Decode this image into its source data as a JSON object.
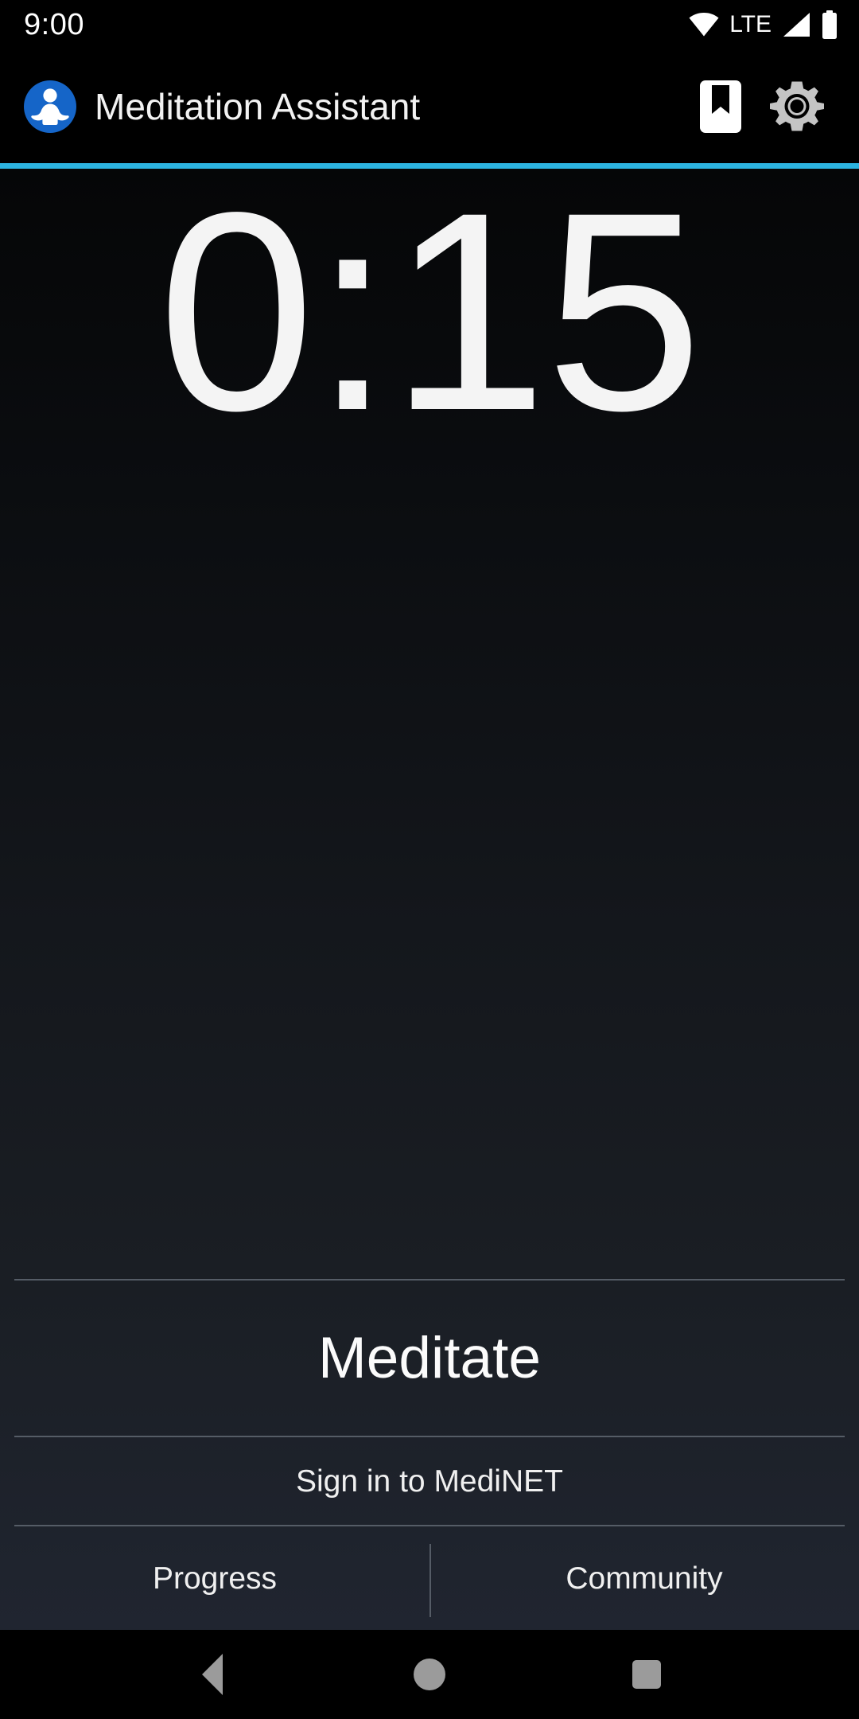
{
  "status_bar": {
    "clock": "9:00",
    "network_label": "LTE",
    "icons": [
      "wifi-icon",
      "cellular-signal-icon",
      "battery-icon"
    ]
  },
  "app_bar": {
    "logo_icon": "meditation-lotus-icon",
    "title": "Meditation Assistant",
    "actions": [
      {
        "icon": "bookmark-icon",
        "name": "bookmark-button"
      },
      {
        "icon": "gear-icon",
        "name": "settings-button"
      }
    ],
    "accent_color": "#2cb3e0"
  },
  "timer": {
    "value": "0:15"
  },
  "actions": {
    "meditate_label": "Meditate",
    "signin_label": "Sign in to MediNET",
    "tabs": [
      {
        "label": "Progress"
      },
      {
        "label": "Community"
      }
    ]
  },
  "nav_bar": {
    "back": "back-icon",
    "home": "home-icon",
    "recents": "recents-icon"
  },
  "colors": {
    "accent": "#2cb3e0",
    "logo_blue": "#1565c8",
    "text_primary": "#f4f4f4",
    "divider": "#555c66",
    "nav_icon": "#9b9b9b"
  }
}
